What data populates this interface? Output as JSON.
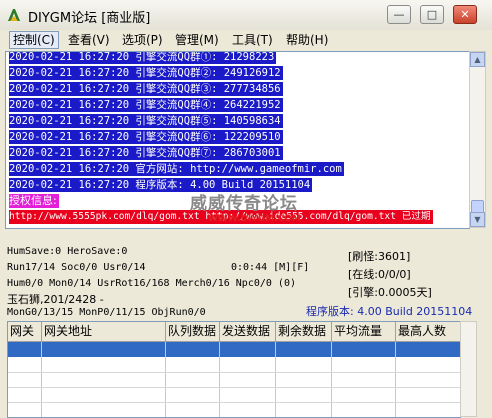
{
  "window": {
    "title": "DIYGM论坛 [商业版]",
    "minimize": "—",
    "maximize": "□",
    "close": "✕"
  },
  "menu": [
    "控制(C)",
    "查看(V)",
    "选项(P)",
    "管理(M)",
    "工具(T)",
    "帮助(H)"
  ],
  "log_lines": [
    "2020-02-21 16:27:20 引擎交流QQ群①: 21298223",
    "2020-02-21 16:27:20 引擎交流QQ群②: 249126912",
    "2020-02-21 16:27:20 引擎交流QQ群③: 277734856",
    "2020-02-21 16:27:20 引擎交流QQ群④: 264221952",
    "2020-02-21 16:27:20 引擎交流QQ群⑤: 140598634",
    "2020-02-21 16:27:20 引擎交流QQ群⑥: 122209510",
    "2020-02-21 16:27:20 引擎交流QQ群⑦: 286703001",
    "2020-02-21 16:27:20 官方网站: http://www.gameofmir.com",
    "2020-02-21 16:27:20 程序版本: 4.00 Build 20151104"
  ],
  "auth_label": "授权信息:",
  "auth_line": "http://www.5555pk.com/dlq/gom.txt http://www.ide555.com/dlq/gom.txt 已过期",
  "watermark": {
    "cn": "威威传奇论坛",
    "url": "WWW.DIYGM.COM"
  },
  "status": {
    "line1": "HumSave:0 HeroSave:0",
    "line2": "Run17/14 Soc0/0 Usr0/14",
    "timer": "0:0:44 [M][F]",
    "line3": "Hum0/0 Mon0/14 UsrRot16/168 Merch0/16 Npc0/0 (0)",
    "line4": "玉石狮,201/2428 -",
    "line5": "MonG0/13/15 MonP0/11/15 ObjRun0/0",
    "refresh": "[刷怪:3601]",
    "online": "[在线:0/0/0]",
    "exp": "[引擎:0.0005天]",
    "version": "程序版本: 4.00 Build 20151104"
  },
  "grid": {
    "columns": [
      "网关",
      "网关地址",
      "队列数据",
      "发送数据",
      "剩余数据",
      "平均流量",
      "最高人数"
    ]
  },
  "colors": {
    "log_bg": "#1a1ac8",
    "auth_bg": "#e21ed6",
    "expired_bg": "#e8001c",
    "selection": "#316ac5"
  }
}
